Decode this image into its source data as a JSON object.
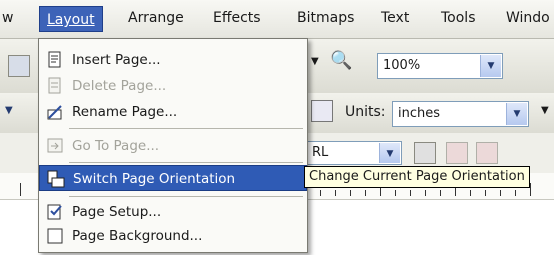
{
  "menubar": {
    "items": [
      {
        "label": "w"
      },
      {
        "label": "Layout",
        "active": true
      },
      {
        "label": "Arrange"
      },
      {
        "label": "Effects"
      },
      {
        "label": "Bitmaps"
      },
      {
        "label": "Text"
      },
      {
        "label": "Tools"
      },
      {
        "label": "Windo"
      }
    ]
  },
  "toolbar": {
    "zoom_value": "100%",
    "units_label": "Units:",
    "units_value": "inches",
    "font_fragment": "RL"
  },
  "layout_menu": {
    "items": [
      {
        "label": "Insert Page...",
        "icon": "insert-page-icon",
        "enabled": true
      },
      {
        "label": "Delete Page...",
        "icon": "delete-page-icon",
        "enabled": false
      },
      {
        "label": "Rename Page...",
        "icon": "rename-page-icon",
        "enabled": true
      },
      {
        "label": "Go To Page...",
        "icon": "go-to-page-icon",
        "enabled": false
      },
      {
        "label": "Switch Page Orientation",
        "icon": "switch-orientation-icon",
        "enabled": true,
        "highlighted": true
      },
      {
        "label": "Page Setup...",
        "icon": "page-setup-icon",
        "enabled": true
      },
      {
        "label": "Page Background...",
        "icon": "page-background-icon",
        "enabled": true
      }
    ]
  },
  "tooltip": {
    "text": "Change Current Page Orientation"
  },
  "colors": {
    "highlight": "#2f5bb5",
    "active_menu": "#3d63b8",
    "tooltip_bg": "#ffffe1",
    "disabled_text": "#a3a39b"
  }
}
